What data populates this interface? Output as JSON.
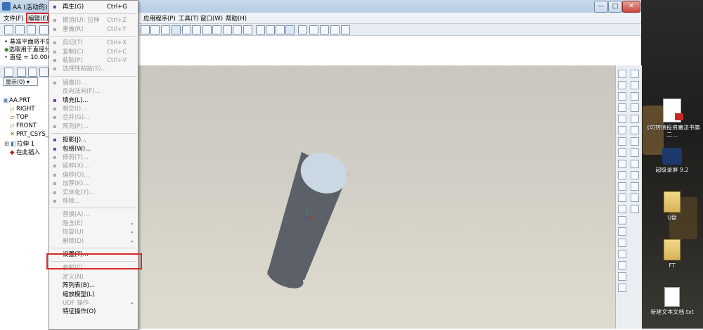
{
  "window": {
    "title": "AA (活动的) - I",
    "controls": [
      "—",
      "□",
      "✕"
    ]
  },
  "menubar": {
    "items_left": [
      "文件(F)",
      "编辑(E)"
    ],
    "items_right": [
      "应用程序(P)",
      "工具(T)",
      "窗口(W)",
      "帮助(H)"
    ]
  },
  "messages": [
    "基准平面将不显",
    "选取用于直径分",
    "直径 = 10.0000"
  ],
  "left_panel": {
    "show_label": "显示(0) ▾",
    "tree": [
      "AA.PRT",
      "RIGHT",
      "TOP",
      "FRONT",
      "PRT_CSYS_",
      "拉伸 1",
      "在此插入"
    ]
  },
  "edit_menu": {
    "items": [
      {
        "label": "再生(G)",
        "accel": "Ctrl+G",
        "enabled": true,
        "icon": "regenerate-icon"
      },
      {
        "sep": true
      },
      {
        "label": "撤消(U): 拉伸",
        "accel": "Ctrl+Z",
        "enabled": false,
        "icon": "undo-icon"
      },
      {
        "label": "重做(R)",
        "accel": "Ctrl+Y",
        "enabled": false,
        "icon": "redo-icon"
      },
      {
        "sep": true
      },
      {
        "label": "剪切(T)",
        "accel": "Ctrl+X",
        "enabled": false,
        "icon": "scissors-icon"
      },
      {
        "label": "复制(C)",
        "accel": "Ctrl+C",
        "enabled": false,
        "icon": "copy-icon"
      },
      {
        "label": "粘贴(P)",
        "accel": "Ctrl+V",
        "enabled": false,
        "icon": "paste-icon"
      },
      {
        "label": "选择性粘贴(S)...",
        "accel": "",
        "enabled": false,
        "icon": "paste-special-icon"
      },
      {
        "sep": true
      },
      {
        "label": "镜像(I)...",
        "accel": "",
        "enabled": false,
        "icon": "mirror-icon"
      },
      {
        "label": "反向法向(F)...",
        "accel": "",
        "enabled": false,
        "icon": ""
      },
      {
        "label": "填充(L)...",
        "accel": "",
        "enabled": true,
        "icon": "fill-icon"
      },
      {
        "label": "相交(I)...",
        "accel": "",
        "enabled": false,
        "icon": "intersect-icon"
      },
      {
        "label": "合并(G)...",
        "accel": "",
        "enabled": false,
        "icon": "merge-icon"
      },
      {
        "label": "阵列(P)...",
        "accel": "",
        "enabled": false,
        "icon": "pattern-icon"
      },
      {
        "sep": true
      },
      {
        "label": "投影(J)...",
        "accel": "",
        "enabled": true,
        "icon": "project-icon"
      },
      {
        "label": "包络(W)...",
        "accel": "",
        "enabled": true,
        "icon": "wrap-icon"
      },
      {
        "label": "修剪(T)...",
        "accel": "",
        "enabled": false,
        "icon": "trim-icon"
      },
      {
        "label": "延伸(X)...",
        "accel": "",
        "enabled": false,
        "icon": "extend-icon"
      },
      {
        "label": "偏移(O)...",
        "accel": "",
        "enabled": false,
        "icon": "offset-icon"
      },
      {
        "label": "加厚(K)...",
        "accel": "",
        "enabled": false,
        "icon": "thicken-icon"
      },
      {
        "label": "实体化(Y)...",
        "accel": "",
        "enabled": false,
        "icon": "solidify-icon"
      },
      {
        "label": "移除...",
        "accel": "",
        "enabled": false,
        "icon": "remove-icon"
      },
      {
        "sep": true
      },
      {
        "label": "替换(A)...",
        "accel": "",
        "enabled": false,
        "icon": ""
      },
      {
        "label": "隐含(E)",
        "accel": "",
        "enabled": false,
        "icon": "",
        "submenu": true
      },
      {
        "label": "恢复(U)",
        "accel": "",
        "enabled": false,
        "icon": "",
        "submenu": true
      },
      {
        "label": "删除(D)",
        "accel": "",
        "enabled": false,
        "icon": "",
        "submenu": true
      },
      {
        "sep": true
      },
      {
        "label": "设置(T)...",
        "accel": "",
        "enabled": true,
        "icon": ""
      },
      {
        "sep": true
      },
      {
        "label": "参照(F)",
        "accel": "",
        "enabled": false,
        "icon": ""
      },
      {
        "label": "定义(N)",
        "accel": "",
        "enabled": false,
        "icon": ""
      },
      {
        "label": "阵列表(B)...",
        "accel": "",
        "enabled": true,
        "icon": ""
      },
      {
        "label": "缩放模型(L)",
        "accel": "",
        "enabled": true,
        "icon": ""
      },
      {
        "label": "UDF 操作",
        "accel": "",
        "enabled": false,
        "icon": "",
        "submenu": true
      },
      {
        "label": "特征操作(O)",
        "accel": "",
        "enabled": true,
        "icon": ""
      }
    ]
  },
  "desktop": {
    "icons": [
      {
        "label": "《可转债投资魔法书第二...",
        "icon": "pdf-document-icon"
      },
      {
        "label": "超级录屏 9.2",
        "icon": "screen-recorder-icon"
      },
      {
        "label": "U盘",
        "icon": "folder-icon"
      },
      {
        "label": "FT",
        "icon": "folder-icon"
      },
      {
        "label": "新建文本文档.txt",
        "icon": "text-file-icon"
      }
    ]
  },
  "colors": {
    "highlight": "#d72b2b",
    "cylinder": "#5c6169",
    "cylinder_top": "#c9d8e3"
  }
}
